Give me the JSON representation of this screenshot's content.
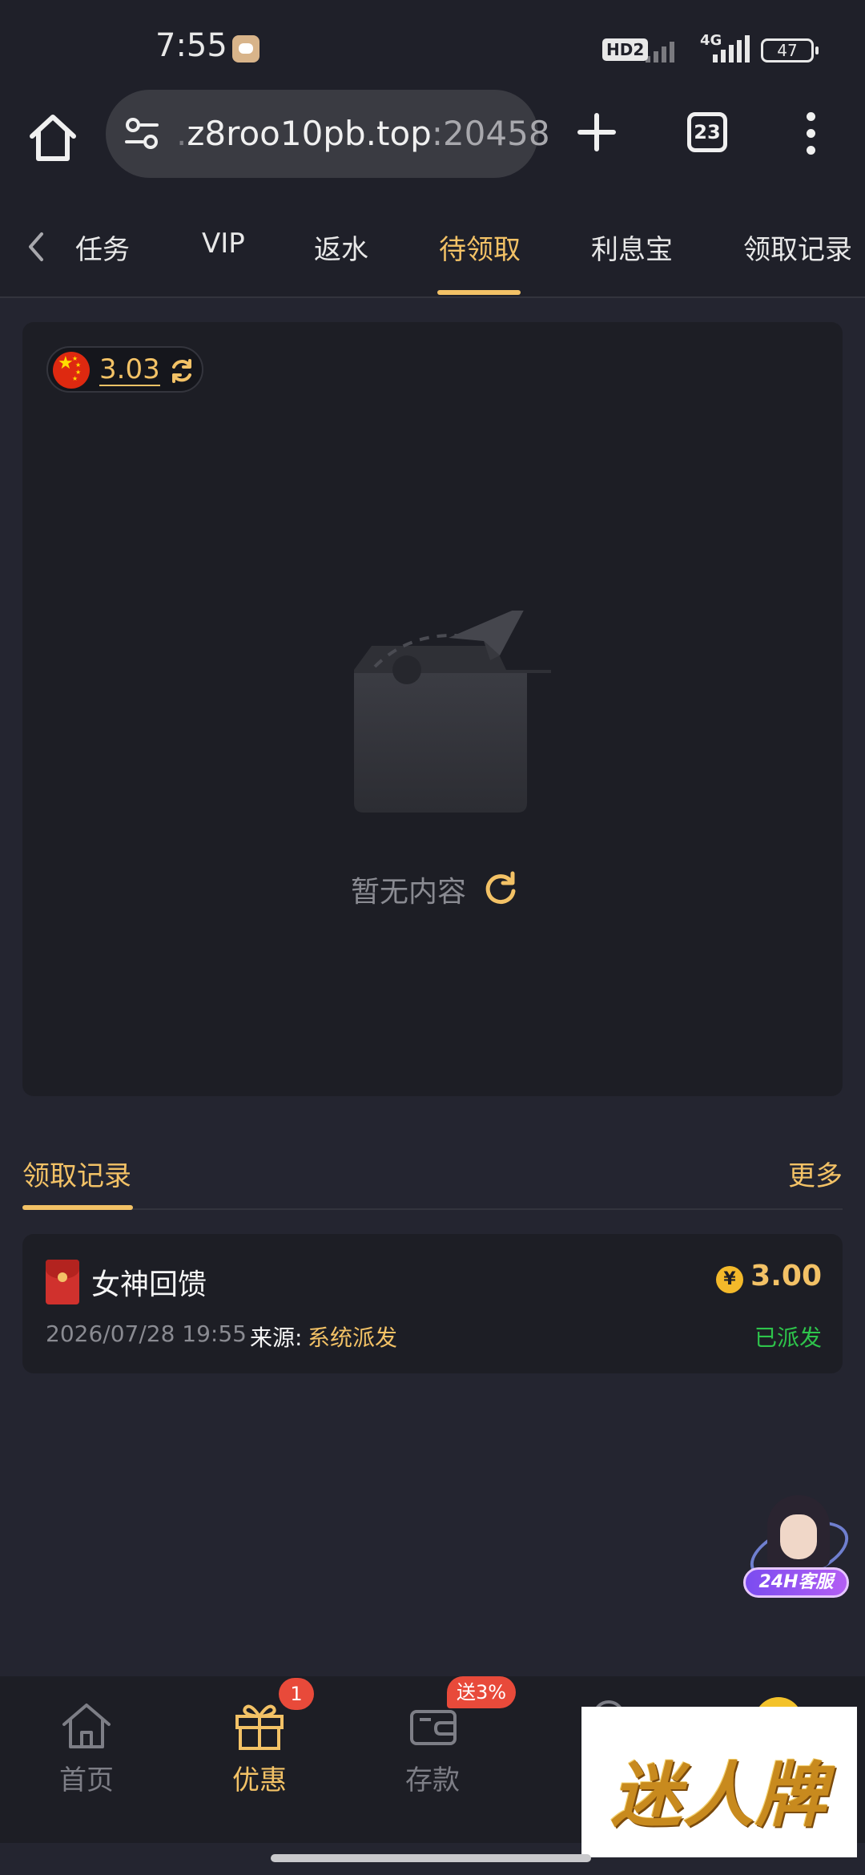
{
  "status_bar": {
    "time": "7:55",
    "hd_label": "HD2",
    "network": "4G",
    "battery": "47"
  },
  "browser": {
    "url_prefix": ".",
    "url_host": "z8roo10pb.top",
    "url_port": ":20458",
    "tab_count": "23"
  },
  "tabs": [
    {
      "label": "任务"
    },
    {
      "label": "VIP"
    },
    {
      "label": "返水"
    },
    {
      "label": "待领取"
    },
    {
      "label": "利息宝"
    },
    {
      "label": "领取记录"
    }
  ],
  "active_tab": "待领取",
  "balance": {
    "value": "3.03",
    "flag": "china-flag-icon"
  },
  "empty_state": {
    "text": "暂无内容"
  },
  "records": {
    "title": "领取记录",
    "more_label": "更多",
    "items": [
      {
        "name": "女神回馈",
        "amount": "3.00",
        "currency_symbol": "¥",
        "date": "2026/07/28 19:55",
        "source_label": "来源:",
        "source": "系统派发",
        "status": "已派发"
      }
    ]
  },
  "service": {
    "badge": "24H客服"
  },
  "bottom_nav": {
    "items": [
      {
        "label": "首页",
        "icon": "home-icon"
      },
      {
        "label": "优惠",
        "icon": "gift-icon",
        "badge": "1"
      },
      {
        "label": "存款",
        "icon": "wallet-icon",
        "badge": "送3%"
      }
    ]
  },
  "watermark": {
    "text": "迷人牌"
  },
  "colors": {
    "accent": "#f3c266",
    "background": "#242530",
    "card": "#1d1e25",
    "status_green": "#2ec44b",
    "badge_red": "#e84a3a"
  }
}
